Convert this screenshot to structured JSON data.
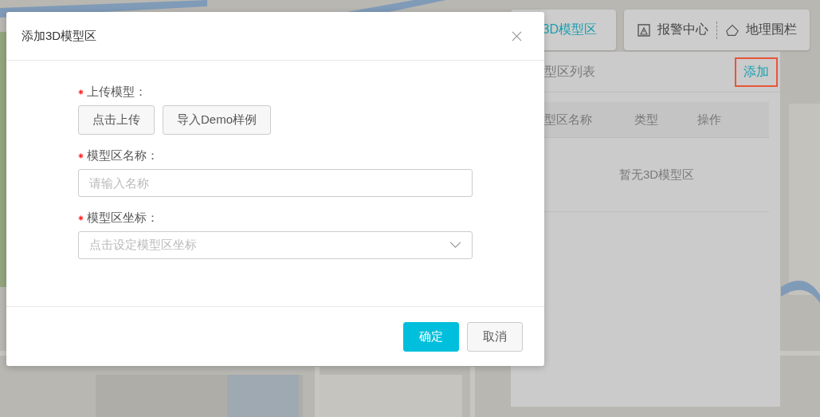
{
  "toolbar": {
    "items": [
      {
        "label": "3D模型区",
        "selected": true
      },
      {
        "label": "报警中心",
        "selected": false,
        "kind": "alarm"
      },
      {
        "label": "地理围栏",
        "selected": false,
        "kind": "fence"
      }
    ]
  },
  "panel": {
    "title": "型区列表",
    "add_button": {
      "label": "添加",
      "highlighted": true
    },
    "table": {
      "columns": [
        "型区名称",
        "类型",
        "操作"
      ],
      "empty_text": "暂无3D模型区"
    }
  },
  "dialog": {
    "title": "添加3D模型区",
    "fields": [
      {
        "kind": "upload",
        "label": "上传模型：",
        "required": true,
        "buttons": [
          "点击上传",
          "导入Demo样例"
        ]
      },
      {
        "kind": "input",
        "label": "模型区名称：",
        "required": true,
        "placeholder": "请输入名称"
      },
      {
        "kind": "select",
        "label": "模型区坐标：",
        "required": true,
        "placeholder": "点击设定模型区坐标"
      }
    ],
    "buttons": [
      {
        "label": "确定",
        "kind": "primary"
      },
      {
        "label": "取消",
        "kind": "default"
      }
    ]
  }
}
